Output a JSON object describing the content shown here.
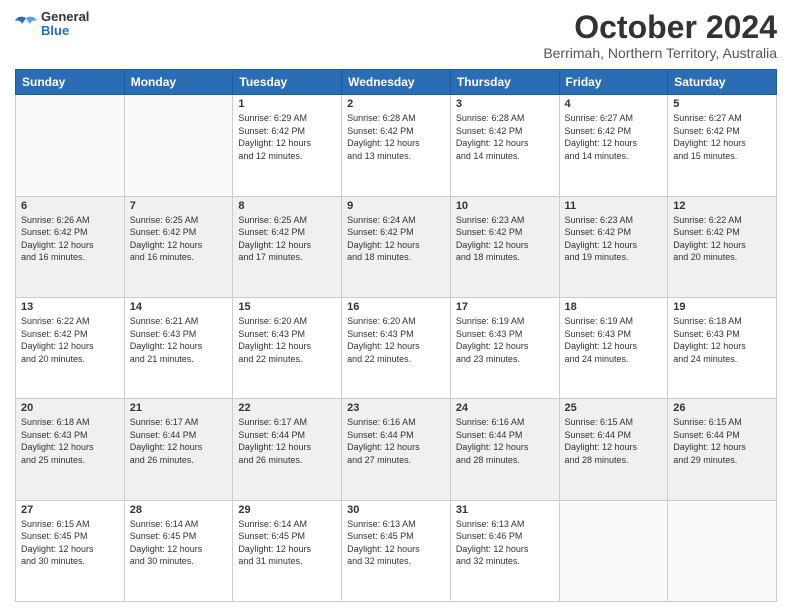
{
  "logo": {
    "general": "General",
    "blue": "Blue"
  },
  "title": "October 2024",
  "location": "Berrimah, Northern Territory, Australia",
  "weekdays": [
    "Sunday",
    "Monday",
    "Tuesday",
    "Wednesday",
    "Thursday",
    "Friday",
    "Saturday"
  ],
  "weeks": [
    [
      {
        "day": "",
        "info": ""
      },
      {
        "day": "",
        "info": ""
      },
      {
        "day": "1",
        "info": "Sunrise: 6:29 AM\nSunset: 6:42 PM\nDaylight: 12 hours\nand 12 minutes."
      },
      {
        "day": "2",
        "info": "Sunrise: 6:28 AM\nSunset: 6:42 PM\nDaylight: 12 hours\nand 13 minutes."
      },
      {
        "day": "3",
        "info": "Sunrise: 6:28 AM\nSunset: 6:42 PM\nDaylight: 12 hours\nand 14 minutes."
      },
      {
        "day": "4",
        "info": "Sunrise: 6:27 AM\nSunset: 6:42 PM\nDaylight: 12 hours\nand 14 minutes."
      },
      {
        "day": "5",
        "info": "Sunrise: 6:27 AM\nSunset: 6:42 PM\nDaylight: 12 hours\nand 15 minutes."
      }
    ],
    [
      {
        "day": "6",
        "info": "Sunrise: 6:26 AM\nSunset: 6:42 PM\nDaylight: 12 hours\nand 16 minutes."
      },
      {
        "day": "7",
        "info": "Sunrise: 6:25 AM\nSunset: 6:42 PM\nDaylight: 12 hours\nand 16 minutes."
      },
      {
        "day": "8",
        "info": "Sunrise: 6:25 AM\nSunset: 6:42 PM\nDaylight: 12 hours\nand 17 minutes."
      },
      {
        "day": "9",
        "info": "Sunrise: 6:24 AM\nSunset: 6:42 PM\nDaylight: 12 hours\nand 18 minutes."
      },
      {
        "day": "10",
        "info": "Sunrise: 6:23 AM\nSunset: 6:42 PM\nDaylight: 12 hours\nand 18 minutes."
      },
      {
        "day": "11",
        "info": "Sunrise: 6:23 AM\nSunset: 6:42 PM\nDaylight: 12 hours\nand 19 minutes."
      },
      {
        "day": "12",
        "info": "Sunrise: 6:22 AM\nSunset: 6:42 PM\nDaylight: 12 hours\nand 20 minutes."
      }
    ],
    [
      {
        "day": "13",
        "info": "Sunrise: 6:22 AM\nSunset: 6:42 PM\nDaylight: 12 hours\nand 20 minutes."
      },
      {
        "day": "14",
        "info": "Sunrise: 6:21 AM\nSunset: 6:43 PM\nDaylight: 12 hours\nand 21 minutes."
      },
      {
        "day": "15",
        "info": "Sunrise: 6:20 AM\nSunset: 6:43 PM\nDaylight: 12 hours\nand 22 minutes."
      },
      {
        "day": "16",
        "info": "Sunrise: 6:20 AM\nSunset: 6:43 PM\nDaylight: 12 hours\nand 22 minutes."
      },
      {
        "day": "17",
        "info": "Sunrise: 6:19 AM\nSunset: 6:43 PM\nDaylight: 12 hours\nand 23 minutes."
      },
      {
        "day": "18",
        "info": "Sunrise: 6:19 AM\nSunset: 6:43 PM\nDaylight: 12 hours\nand 24 minutes."
      },
      {
        "day": "19",
        "info": "Sunrise: 6:18 AM\nSunset: 6:43 PM\nDaylight: 12 hours\nand 24 minutes."
      }
    ],
    [
      {
        "day": "20",
        "info": "Sunrise: 6:18 AM\nSunset: 6:43 PM\nDaylight: 12 hours\nand 25 minutes."
      },
      {
        "day": "21",
        "info": "Sunrise: 6:17 AM\nSunset: 6:44 PM\nDaylight: 12 hours\nand 26 minutes."
      },
      {
        "day": "22",
        "info": "Sunrise: 6:17 AM\nSunset: 6:44 PM\nDaylight: 12 hours\nand 26 minutes."
      },
      {
        "day": "23",
        "info": "Sunrise: 6:16 AM\nSunset: 6:44 PM\nDaylight: 12 hours\nand 27 minutes."
      },
      {
        "day": "24",
        "info": "Sunrise: 6:16 AM\nSunset: 6:44 PM\nDaylight: 12 hours\nand 28 minutes."
      },
      {
        "day": "25",
        "info": "Sunrise: 6:15 AM\nSunset: 6:44 PM\nDaylight: 12 hours\nand 28 minutes."
      },
      {
        "day": "26",
        "info": "Sunrise: 6:15 AM\nSunset: 6:44 PM\nDaylight: 12 hours\nand 29 minutes."
      }
    ],
    [
      {
        "day": "27",
        "info": "Sunrise: 6:15 AM\nSunset: 6:45 PM\nDaylight: 12 hours\nand 30 minutes."
      },
      {
        "day": "28",
        "info": "Sunrise: 6:14 AM\nSunset: 6:45 PM\nDaylight: 12 hours\nand 30 minutes."
      },
      {
        "day": "29",
        "info": "Sunrise: 6:14 AM\nSunset: 6:45 PM\nDaylight: 12 hours\nand 31 minutes."
      },
      {
        "day": "30",
        "info": "Sunrise: 6:13 AM\nSunset: 6:45 PM\nDaylight: 12 hours\nand 32 minutes."
      },
      {
        "day": "31",
        "info": "Sunrise: 6:13 AM\nSunset: 6:46 PM\nDaylight: 12 hours\nand 32 minutes."
      },
      {
        "day": "",
        "info": ""
      },
      {
        "day": "",
        "info": ""
      }
    ]
  ]
}
